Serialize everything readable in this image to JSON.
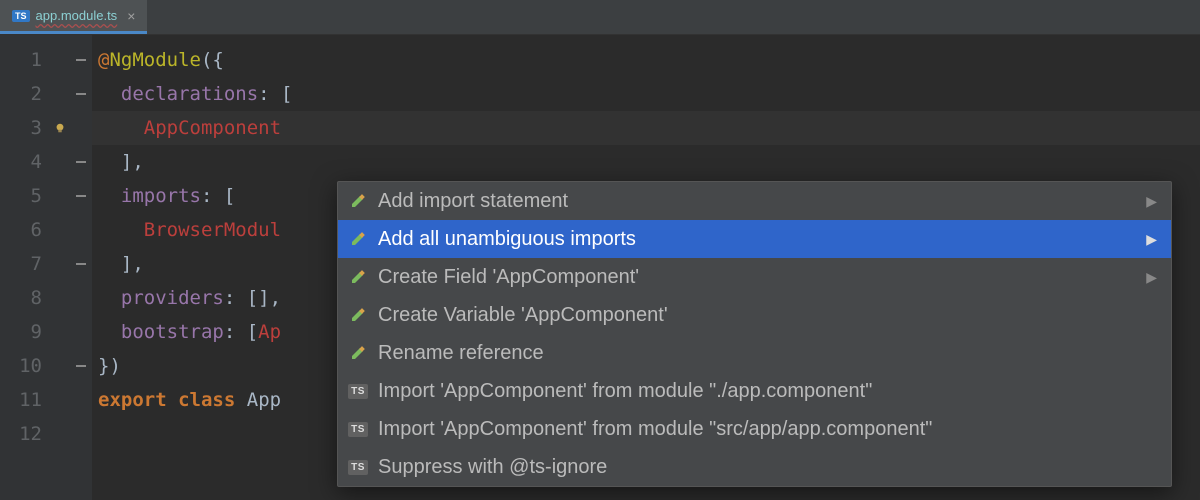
{
  "tab": {
    "badge": "TS",
    "filename": "app.module.ts",
    "close": "×"
  },
  "gutter": {
    "lines": [
      "1",
      "2",
      "3",
      "4",
      "5",
      "6",
      "7",
      "8",
      "9",
      "10",
      "11",
      "12"
    ]
  },
  "code": {
    "l1": {
      "at": "@",
      "decor": "NgModule",
      "open": "({"
    },
    "l2": {
      "key": "declarations",
      "colon": ": [",
      "indent": "  "
    },
    "l3": {
      "val": "AppComponent",
      "indent": "    "
    },
    "l4": {
      "close": "],",
      "indent": "  "
    },
    "l5": {
      "key": "imports",
      "colon": ": [",
      "indent": "  "
    },
    "l6": {
      "val": "BrowserModul",
      "indent": "    "
    },
    "l7": {
      "close": "],",
      "indent": "  "
    },
    "l8": {
      "key": "providers",
      "colon": ": [],",
      "indent": "  "
    },
    "l9": {
      "key": "bootstrap",
      "colon": ": [",
      "val": "Ap",
      "indent": "  "
    },
    "l10": {
      "close": "})"
    },
    "l11": {
      "kw1": "export",
      "kw2": "class",
      "name": "App"
    }
  },
  "popup": {
    "items": [
      {
        "icon": "pencil",
        "label": "Add import statement",
        "arrow": true
      },
      {
        "icon": "pencil",
        "label": "Add all unambiguous imports",
        "arrow": true,
        "selected": true
      },
      {
        "icon": "pencil",
        "label": "Create Field 'AppComponent'",
        "arrow": true
      },
      {
        "icon": "pencil",
        "label": "Create Variable 'AppComponent'",
        "arrow": false
      },
      {
        "icon": "pencil",
        "label": "Rename reference",
        "arrow": false
      },
      {
        "icon": "ts",
        "label": "Import 'AppComponent' from module \"./app.component\"",
        "arrow": false
      },
      {
        "icon": "ts",
        "label": "Import 'AppComponent' from module \"src/app/app.component\"",
        "arrow": false
      },
      {
        "icon": "ts",
        "label": "Suppress with @ts-ignore",
        "arrow": false
      }
    ],
    "tsBadge": "TS"
  }
}
